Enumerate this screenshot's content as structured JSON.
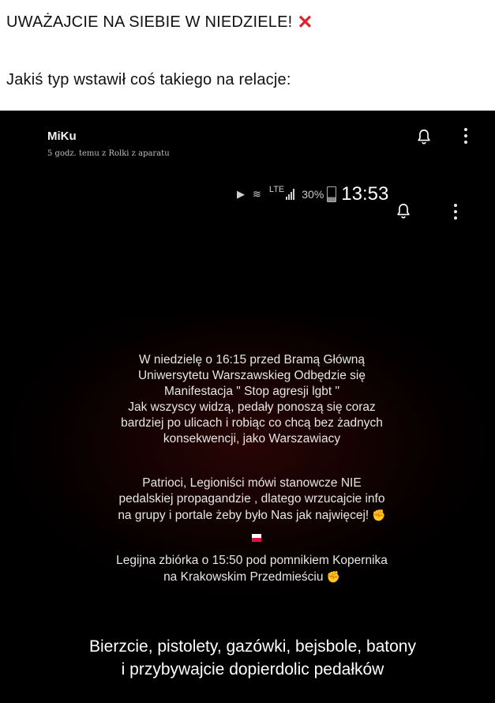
{
  "post": {
    "title": "UWAŻAJCIE NA SIEBIE W NIEDZIELE!",
    "subtitle": "Jakiś typ wstawił coś takiego na relacje:"
  },
  "story": {
    "username": "MiKu",
    "meta": "5 godz. temu z Rolki z aparatu"
  },
  "status_bar": {
    "network": "LTE",
    "battery": "30%",
    "time": "13:53"
  },
  "message": {
    "paragraph1": [
      "W niedzielę o 16:15 przed Bramą Główną",
      "Uniwersytetu Warszawskieg Odbędzie się",
      "Manifestacja \" Stop agresji lgbt \"",
      "Jak wszyscy widzą, pedały ponoszą się coraz",
      "bardziej po ulicach i robiąc co chcą bez żadnych",
      "konsekwencji,  jako Warszawiacy"
    ],
    "paragraph2": [
      "Patrioci,  Legioniści mówi stanowcze NIE",
      "pedalskiej propagandzie , dlatego wrzucajcie info",
      "na grupy i portale żeby było Nas jak najwięcej!"
    ],
    "paragraph3": [
      "Legijna zbiórka o 15:50 pod pomnikiem Kopernika",
      "na Krakowskim Przedmieściu"
    ]
  },
  "caption": {
    "line1": "Bierzcie, pistolety, gazówki, bejsbole, batony",
    "line2": "i przybywajcie dopierdolic pedałków"
  },
  "icons": {
    "title_mark": "cross-mark-icon",
    "bell": "bell-icon",
    "more": "kebab-menu-icon",
    "fist": "fist-emoji",
    "flag": "poland-flag-emoji"
  },
  "colors": {
    "cross_mark": "#e0242f",
    "fist": "#f1c232",
    "flag_white": "#ffffff",
    "flag_red": "#dc143c"
  }
}
